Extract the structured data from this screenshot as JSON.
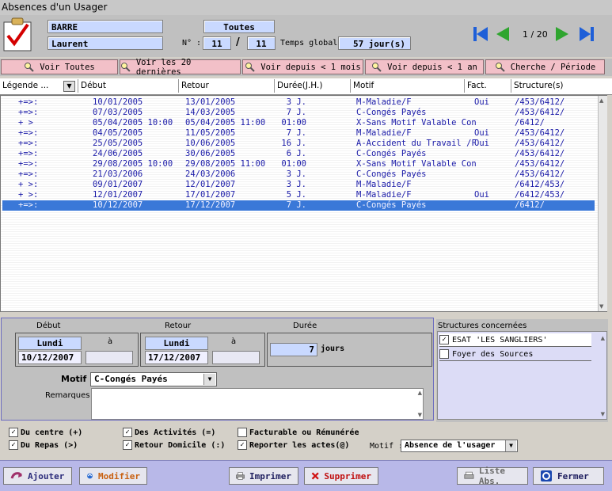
{
  "window": {
    "title": "Absences d'un Usager"
  },
  "patient": {
    "last_name": "BARRE",
    "first_name": "Laurent"
  },
  "filter": {
    "label": "Toutes"
  },
  "record": {
    "no_label": "N° :",
    "current": "11",
    "sep": "/",
    "total": "11"
  },
  "global_time": {
    "label": "Temps global :",
    "value": "57",
    "unit": "jour(s)"
  },
  "nav": {
    "page": "1 / 20"
  },
  "filter_buttons": [
    "Voir Toutes",
    "Voir les 20 dernières",
    "Voir depuis < 1 mois",
    "Voir depuis < 1 an",
    "Cherche / Période"
  ],
  "columns": {
    "legend": "Légende ...",
    "start": "Début",
    "return": "Retour",
    "duration": "Durée(J.H.)",
    "reason": "Motif",
    "billed": "Fact.",
    "structure": "Structure(s)"
  },
  "rows": [
    {
      "flag": "+=>:",
      "start": "10/01/2005",
      "ret": "13/01/2005",
      "dur": "3 J.",
      "reason": "M-Maladie/F",
      "fact": "Oui",
      "struct": "/453/6412/"
    },
    {
      "flag": "+=>:",
      "start": "07/03/2005",
      "ret": "14/03/2005",
      "dur": "7 J.",
      "reason": "C-Congés Payés",
      "fact": "",
      "struct": "/453/6412/"
    },
    {
      "flag": "+ >",
      "start": "05/04/2005 10:00",
      "ret": "05/04/2005 11:00",
      "dur": "01:00",
      "reason": "X-Sans Motif Valable Con",
      "fact": "",
      "struct": "/6412/"
    },
    {
      "flag": "+=>:",
      "start": "04/05/2005",
      "ret": "11/05/2005",
      "dur": "7 J.",
      "reason": "M-Maladie/F",
      "fact": "Oui",
      "struct": "/453/6412/"
    },
    {
      "flag": "+=>:",
      "start": "25/05/2005",
      "ret": "10/06/2005",
      "dur": "16 J.",
      "reason": "A-Accident du Travail /F",
      "fact": "Oui",
      "struct": "/453/6412/"
    },
    {
      "flag": "+=>:",
      "start": "24/06/2005",
      "ret": "30/06/2005",
      "dur": "6 J.",
      "reason": "C-Congés Payés",
      "fact": "",
      "struct": "/453/6412/"
    },
    {
      "flag": "+=>:",
      "start": "29/08/2005 10:00",
      "ret": "29/08/2005 11:00",
      "dur": "01:00",
      "reason": "X-Sans Motif Valable Con",
      "fact": "",
      "struct": "/453/6412/"
    },
    {
      "flag": "+=>:",
      "start": "21/03/2006",
      "ret": "24/03/2006",
      "dur": "3 J.",
      "reason": "C-Congés Payés",
      "fact": "",
      "struct": "/453/6412/"
    },
    {
      "flag": "+ >:",
      "start": "09/01/2007",
      "ret": "12/01/2007",
      "dur": "3 J.",
      "reason": "M-Maladie/F",
      "fact": "",
      "struct": "/6412/453/"
    },
    {
      "flag": "+ >:",
      "start": "12/01/2007",
      "ret": "17/01/2007",
      "dur": "5 J.",
      "reason": "M-Maladie/F",
      "fact": "Oui",
      "struct": "/6412/453/"
    },
    {
      "flag": "+=>:",
      "start": "10/12/2007",
      "ret": "17/12/2007",
      "dur": "7 J.",
      "reason": "C-Congés Payés",
      "fact": "",
      "struct": "/6412/"
    }
  ],
  "detail": {
    "start_label": "Début",
    "return_label": "Retour",
    "duration_label": "Durée",
    "a_label": "à",
    "start_day": "Lundi",
    "start_date": "10/12/2007",
    "return_day": "Lundi",
    "return_date": "17/12/2007",
    "duration_value": "7",
    "duration_unit": "jours",
    "reason_label": "Motif",
    "reason_value": "C-Congés Payés",
    "remarks_label": "Remarques"
  },
  "checks": {
    "centre": "Du centre (+)",
    "repas": "Du Repas (>)",
    "activites": "Des Activités (=)",
    "retour": "Retour Domicile (:)",
    "facturable": "Facturable ou Rémunérée",
    "reporter": "Reporter les actes(@)",
    "motif_label": "Motif :",
    "motif_value": "Absence de l'usager"
  },
  "structures": {
    "title": "Structures concernées",
    "items": [
      "ESAT 'LES SANGLIERS'",
      "Foyer des Sources"
    ]
  },
  "buttons": {
    "add": "Ajouter",
    "modify": "Modifier",
    "print": "Imprimer",
    "delete": "Supprimer",
    "list": "Liste Abs.",
    "close": "Fermer"
  }
}
